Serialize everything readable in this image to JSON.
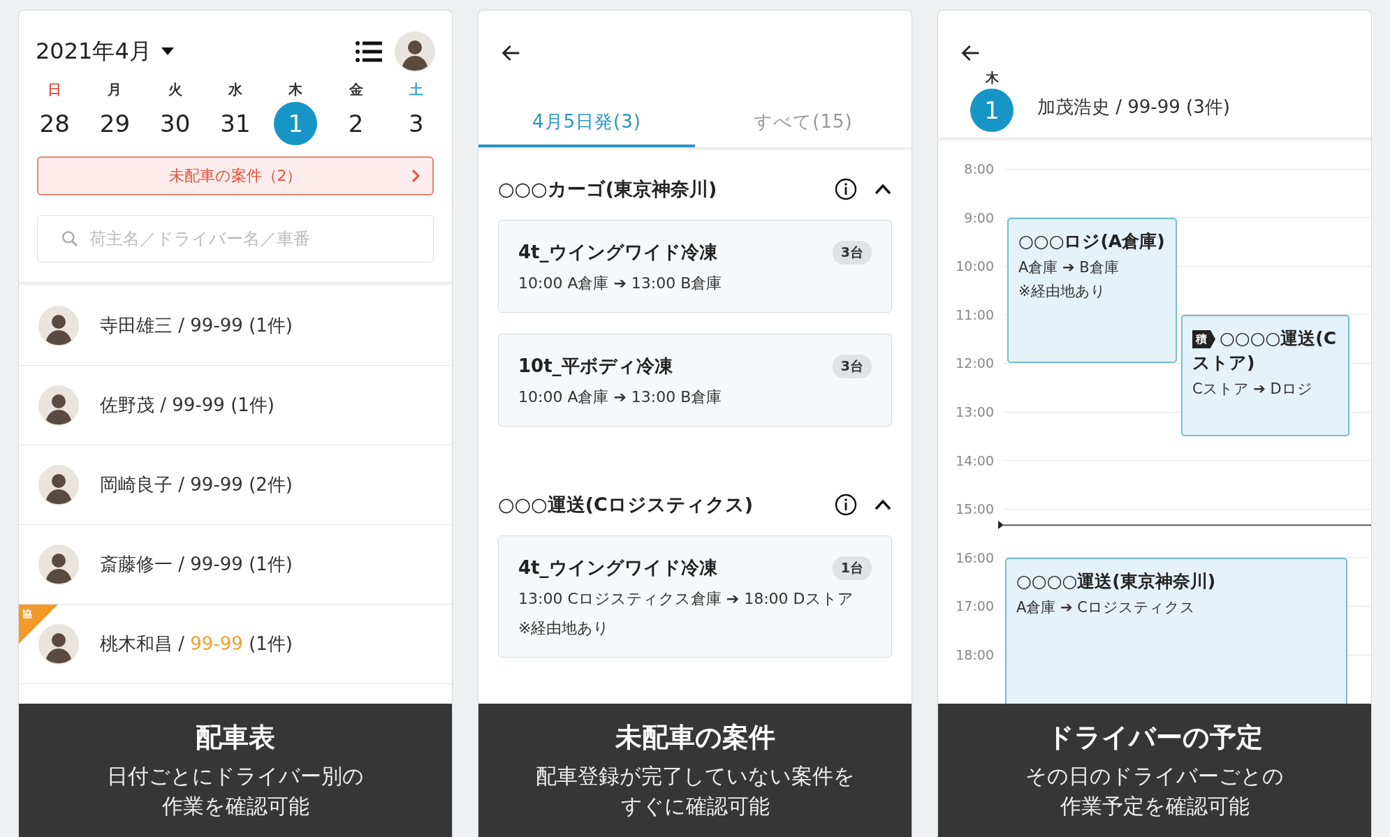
{
  "dispatch_table": {
    "month": "2021年4月",
    "weekdays": [
      {
        "label": "日",
        "date": "28",
        "color": "#e0594e",
        "selected": false
      },
      {
        "label": "月",
        "date": "29",
        "color": "#333333",
        "selected": false
      },
      {
        "label": "火",
        "date": "30",
        "color": "#333333",
        "selected": false
      },
      {
        "label": "水",
        "date": "31",
        "color": "#333333",
        "selected": false
      },
      {
        "label": "木",
        "date": "1",
        "color": "#333333",
        "selected": true
      },
      {
        "label": "金",
        "date": "2",
        "color": "#333333",
        "selected": false
      },
      {
        "label": "土",
        "date": "3",
        "color": "#2ea6d6",
        "selected": false
      }
    ],
    "unassigned_banner": "未配車の案件（2）",
    "search": {
      "placeholder": "荷主名／ドライバー名／車番"
    },
    "drivers": {
      "separator": "/",
      "items": [
        {
          "name": "寺田雄三",
          "plate": "99-99",
          "count": "(1件)",
          "partner": false
        },
        {
          "name": "佐野茂",
          "plate": "99-99",
          "count": "(1件)",
          "partner": false
        },
        {
          "name": "岡崎良子",
          "plate": "99-99",
          "count": "(2件)",
          "partner": false
        },
        {
          "name": "斎藤修一",
          "plate": "99-99",
          "count": "(1件)",
          "partner": false
        },
        {
          "name": "桃木和昌",
          "plate": "99-99",
          "count": "(1件)",
          "partner": true,
          "tag": "協"
        }
      ]
    },
    "caption": {
      "title": "配車表",
      "lines": [
        "日付ごとにドライバー別の",
        "作業を確認可能"
      ]
    }
  },
  "unassigned_jobs": {
    "tabs": [
      {
        "label": "4月5日発(3)",
        "selected": true
      },
      {
        "label": "すべて(15)",
        "selected": false
      }
    ],
    "groups": [
      {
        "name": "○○○カーゴ(東京神奈川)",
        "expanded": true,
        "cards": [
          {
            "title": "4t_ウイングワイド冷凍",
            "count": "3台",
            "route": "10:00 A倉庫 ➔ 13:00 B倉庫"
          },
          {
            "title": "10t_平ボディ冷凍",
            "count": "3台",
            "route": "10:00 A倉庫 ➔ 13:00 B倉庫"
          }
        ]
      },
      {
        "name": "○○○運送(Cロジスティクス)",
        "expanded": true,
        "cards": [
          {
            "title": "4t_ウイングワイド冷凍",
            "count": "1台",
            "route": "13:00 Cロジスティクス倉庫 ➔ 18:00 Dストア",
            "note": "※経由地あり"
          }
        ]
      }
    ],
    "caption": {
      "title": "未配車の案件",
      "lines": [
        "配車登録が完了していない案件を",
        "すぐに確認可能"
      ]
    }
  },
  "driver_schedule": {
    "weekday": "木",
    "date": "1",
    "driver": "加茂浩史 / 99-99 (3件)",
    "hours": [
      "8:00",
      "9:00",
      "10:00",
      "11:00",
      "12:00",
      "13:00",
      "14:00",
      "15:00",
      "16:00",
      "17:00",
      "18:00"
    ],
    "events": [
      {
        "title": "○○○ロジ(A倉庫)",
        "route": "A倉庫 ➔ B倉庫",
        "note": "※経由地あり"
      },
      {
        "tag": "積",
        "title": "○○○○運送(Cストア)",
        "route": "Cストア ➔ Dロジ"
      },
      {
        "title": "○○○○運送(東京神奈川)",
        "route": "A倉庫 ➔ Cロジスティクス"
      }
    ],
    "caption": {
      "title": "ドライバーの予定",
      "lines": [
        "その日のドライバーごとの",
        "作業予定を確認可能"
      ]
    }
  }
}
